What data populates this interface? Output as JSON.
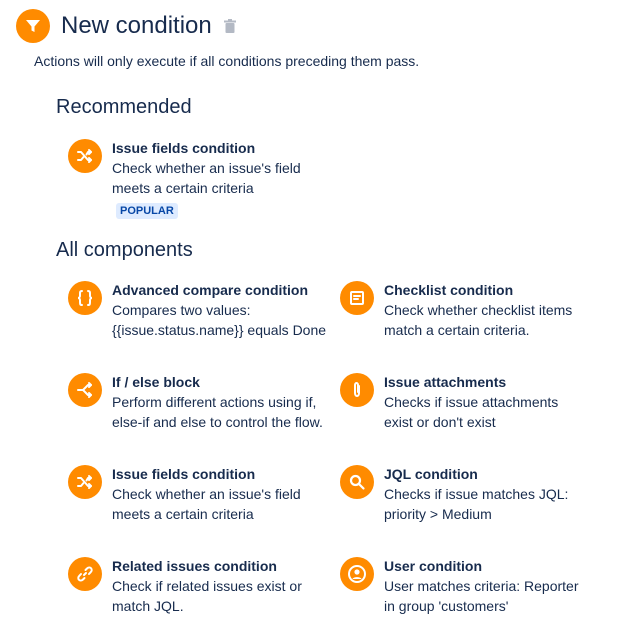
{
  "header": {
    "title": "New condition",
    "subtitle": "Actions will only execute if all conditions preceding them pass."
  },
  "recommended": {
    "heading": "Recommended",
    "item": {
      "title": "Issue fields condition",
      "desc": "Check whether an issue's field meets a certain criteria",
      "badge": "POPULAR",
      "icon": "shuffle-icon"
    }
  },
  "all_components": {
    "heading": "All components",
    "items": [
      {
        "title": "Advanced compare condition",
        "desc": "Compares two values: {{issue.status.name}} equals Done",
        "icon": "braces-icon"
      },
      {
        "title": "Checklist condition",
        "desc": "Check whether checklist items match a certain criteria.",
        "icon": "checklist-icon"
      },
      {
        "title": "If / else block",
        "desc": "Perform different actions using if, else-if and else to control the flow.",
        "icon": "branch-icon"
      },
      {
        "title": "Issue attachments",
        "desc": "Checks if issue attachments exist or don't exist",
        "icon": "paperclip-icon"
      },
      {
        "title": "Issue fields condition",
        "desc": "Check whether an issue's field meets a certain criteria",
        "icon": "shuffle-icon"
      },
      {
        "title": "JQL condition",
        "desc": "Checks if issue matches JQL: priority > Medium",
        "icon": "search-icon"
      },
      {
        "title": "Related issues condition",
        "desc": "Check if related issues exist or match JQL.",
        "icon": "link-icon"
      },
      {
        "title": "User condition",
        "desc": "User matches criteria: Reporter in group 'customers'",
        "icon": "user-icon"
      }
    ]
  },
  "colors": {
    "accent": "#ff8b00",
    "badge_bg": "#deebff",
    "badge_text": "#0747a6",
    "text": "#172b4d"
  }
}
